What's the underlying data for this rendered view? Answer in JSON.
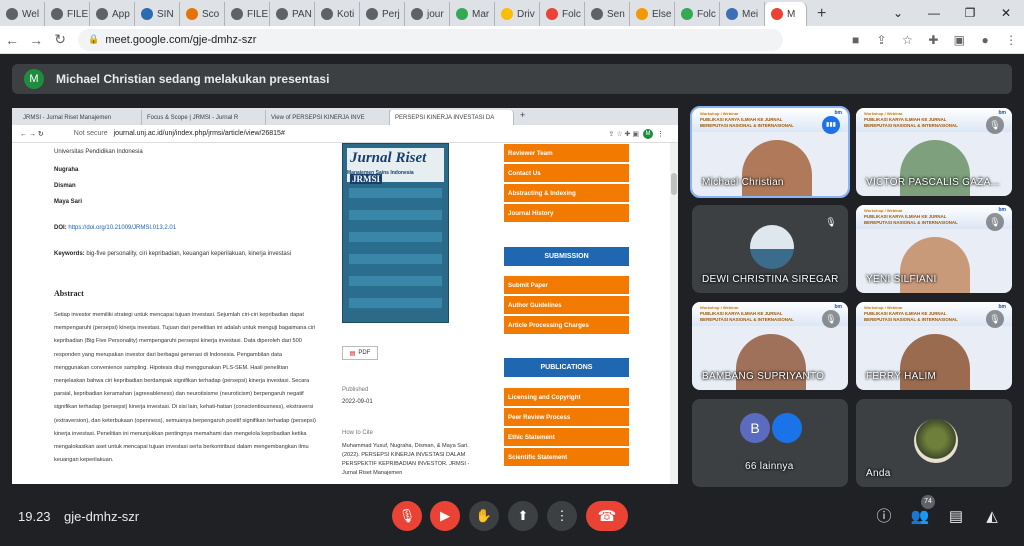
{
  "browser": {
    "tabs": [
      {
        "label": "Wel",
        "icon": "globe-icon",
        "color": "#5f6368"
      },
      {
        "label": "FILE",
        "icon": "globe-icon",
        "color": "#5f6368"
      },
      {
        "label": "App",
        "icon": "globe-icon",
        "color": "#5f6368"
      },
      {
        "label": "SIN",
        "icon": "globe-icon",
        "color": "#2b6cb0"
      },
      {
        "label": "Sco",
        "icon": "scopus-icon",
        "color": "#e37400"
      },
      {
        "label": "FILE",
        "icon": "globe-icon",
        "color": "#5f6368"
      },
      {
        "label": "PAN",
        "icon": "globe-icon",
        "color": "#5f6368"
      },
      {
        "label": "Koti",
        "icon": "globe-icon",
        "color": "#5f6368"
      },
      {
        "label": "Perj",
        "icon": "globe-icon",
        "color": "#5f6368"
      },
      {
        "label": "jour",
        "icon": "globe-icon",
        "color": "#5f6368"
      },
      {
        "label": "Mar",
        "icon": "drive-icon",
        "color": "#34a853"
      },
      {
        "label": "Driv",
        "icon": "drive-icon",
        "color": "#fbbc04"
      },
      {
        "label": "Folc",
        "icon": "gmail-icon",
        "color": "#ea4335"
      },
      {
        "label": "Sen",
        "icon": "globe-icon",
        "color": "#5f6368"
      },
      {
        "label": "Else",
        "icon": "api-icon",
        "color": "#f29900"
      },
      {
        "label": "Folc",
        "icon": "drive-icon",
        "color": "#34a853"
      },
      {
        "label": "Mei",
        "icon": "globe-icon",
        "color": "#3c6fb4"
      },
      {
        "label": "M",
        "icon": "record-icon",
        "color": "#ea4335"
      }
    ],
    "url": "meet.google.com/gje-dmhz-szr"
  },
  "meet": {
    "presenter_initial": "M",
    "presenter_banner": "Michael Christian sedang melakukan presentasi",
    "clock": "19.23",
    "meeting_code": "gje-dmhz-szr",
    "participant_count": "74",
    "tiles": [
      {
        "name": "Michael Christian",
        "speaking": true
      },
      {
        "name": "VICTOR PASCALIS GAZA...",
        "speaking": false
      },
      {
        "name": "DEWI CHRISTINA SIREGAR",
        "speaking": false
      },
      {
        "name": "YENI SILFIANI",
        "speaking": false
      },
      {
        "name": "BAMBANG SUPRIYANTO",
        "speaking": false
      },
      {
        "name": "FERRY HALIM",
        "speaking": false
      },
      {
        "name": "66 lainnya",
        "speaking": false
      },
      {
        "name": "Anda",
        "speaking": false
      }
    ],
    "others_initial": "B",
    "webinar_line1": "Workshop / Webinar",
    "webinar_line2": "PUBLIKASI KARYA ILMIAH KE JURNAL BEREPUTASI NASIONAL & INTERNASIONAL",
    "badge_text": "bm"
  },
  "shared_screen": {
    "tabs": [
      "JRMSI - Jurnal Riset Manajemen",
      "Focus & Scope | JRMSI - Jurnal R",
      "View of PERSEPSI KINERJA INVE",
      "PERSEPSI KINERJA INVESTASI DA"
    ],
    "new_tab": "+",
    "not_secure": "Not secure",
    "url": "journal.unj.ac.id/unj/index.php/jrmsi/article/view/26815#",
    "profile_initial": "M",
    "affiliation": "Universitas Pendidikan Indonesia",
    "authors": [
      "Nugraha",
      "Disman",
      "Maya Sari"
    ],
    "doi_label": "DOI:",
    "doi": "https://doi.org/10.21009/JRMSI.013.2.01",
    "keywords_label": "Keywords:",
    "keywords": "big-five personality, ciri kepribadian, keuangan keperilakuan, kinerja investasi",
    "abstract_heading": "Abstract",
    "abstract": "Setiap investor memiliki strategi untuk mencapai tujuan investasi. Sejumlah ciri-ciri kepribadian dapat mempengaruhi (persepsi) kinerja investasi. Tujuan dari penelitian ini adalah untuk menguji bagaimana ciri kepribadian (Big Five Personality) mempengaruhi persepsi kinerja investasi. Data diperoleh dari 500 responden yang merupakan investor dari berbagai generasi di Indonesia. Pengambilan data menggunakan convenience sampling. Hipotesis diuji menggunakan PLS-SEM. Hasil penelitian menjelaskan bahwa ciri kepribadian berdampak signifikan terhadap (persepsi) kinerja investasi. Secara parsial, kepribadian keramahan (agreeableness) dan neurotisisme (neuroticism) berpengaruh negatif signifikan terhadap (persepsi) kinerja investasi. Di sisi lain, kehati-hatian (conscientiousness), ekstraversi (extraversion), dan keterbukaan (openness), semuanya berpengaruh positif signifikan terhadap (persepsi) kinerja investasi. Penelitian ini menunjukkan pentingnya memahami dan mengelola kepribadian ketika mengalokasikan aset untuk mencapai tujuan investasi serta berkontribusi dalam mengembangkan ilmu keuangan keperilakuan.",
    "cover_title": "Jurnal Riset",
    "cover_logo": "JRMSI",
    "cover_subtitle": "Manajemen Sains Indonesia",
    "pdf_label": "PDF",
    "published_label": "Published",
    "published_date": "2022-09-01",
    "cite_label": "How to Cite",
    "citation": "Muhammad Yusuf, Nugraha, Disman, & Maya Sari. (2022). PERSEPSI KINERJA INVESTASI DALAM PERSPEKTIF KEPRIBADIAN INVESTOR. JRMSI - Jurnal Riset Manajemen",
    "sidebar_top": [
      "Reviewer Team",
      "Contact Us",
      "Abstracting & Indexing",
      "Journal History"
    ],
    "submission_heading": "SUBMISSION",
    "submission_items": [
      "Submit Paper",
      "Author Guidelines",
      "Article Processing Charges"
    ],
    "publications_heading": "PUBLICATIONS",
    "publication_items": [
      "Licensing and Copyright",
      "Peer Review Process",
      "Ethic Statement",
      "Scientific Statement"
    ]
  },
  "colors": {
    "meet_bg": "#202124",
    "accent_orange": "#f27a00",
    "accent_blue": "#1f67b1",
    "end_call_red": "#ea4335"
  }
}
